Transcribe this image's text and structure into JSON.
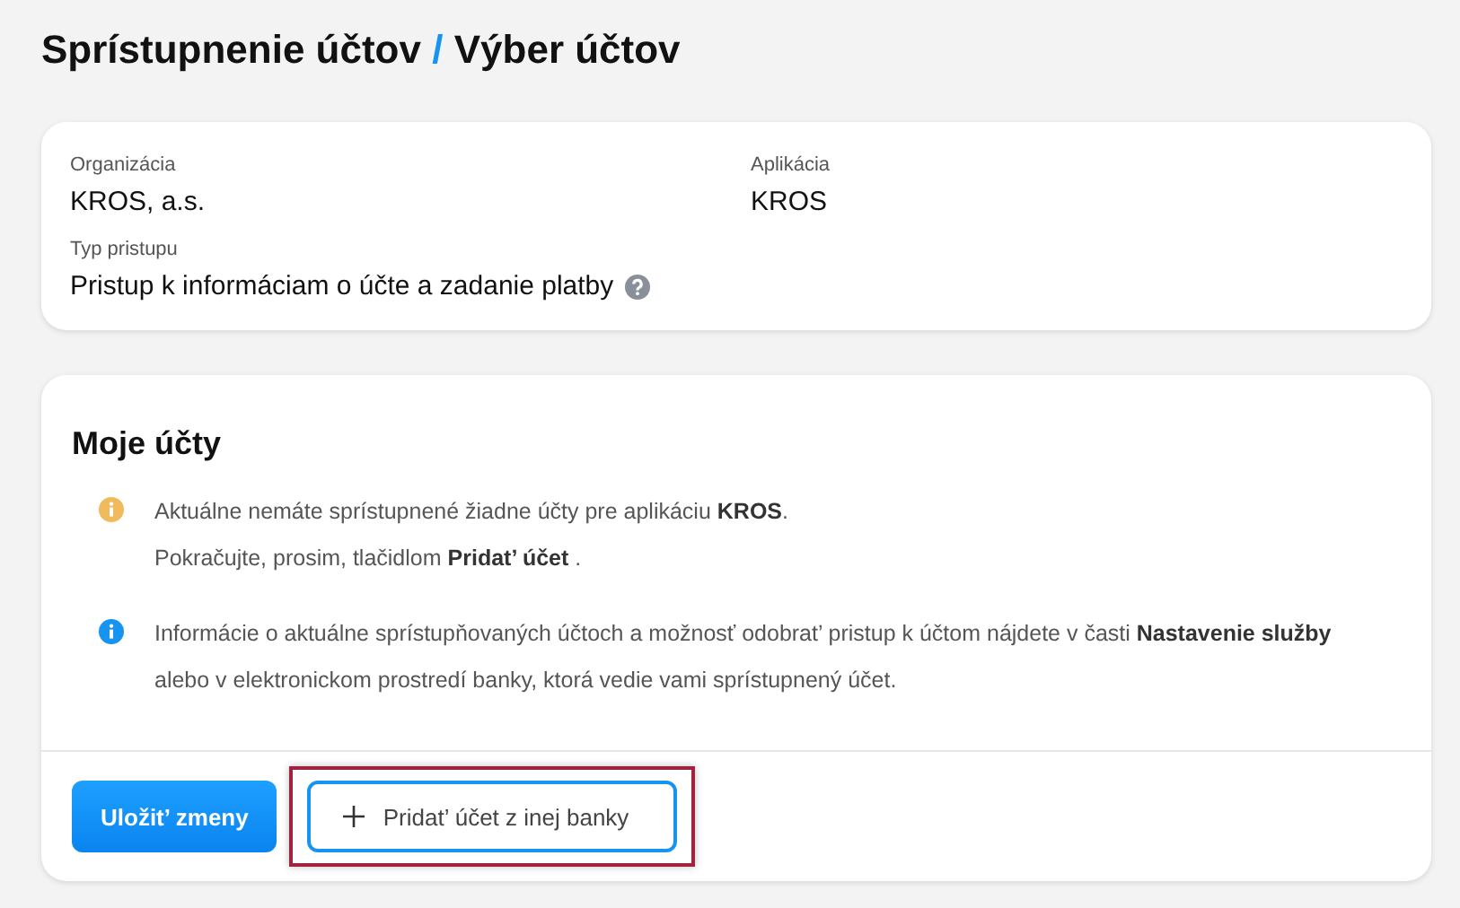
{
  "breadcrumb": [
    {
      "label": "Sprístupnenie účtov"
    },
    {
      "label": "Výber účtov"
    }
  ],
  "separator": "/",
  "details": [
    {
      "label": "Organizácia",
      "value": "KROS, a.s."
    },
    {
      "label": "Aplikácia",
      "value": "KROS"
    },
    {
      "label": "Typ pristupu",
      "value": "Pristup k informáciam o účte a zadanie platby",
      "help": true
    }
  ],
  "accounts": {
    "title": "Moje účty",
    "messages": [
      {
        "kind": "warning",
        "lines": [
          "Aktuálne nemáte sprístupnené žiadne účty pre aplikáciu **KROS**.",
          "Pokračujte, prosim, tlačidlom **Pridat’ účet** ."
        ]
      },
      {
        "kind": "info",
        "lines": [
          "Informácie o aktuálne sprístupňovaných účtoch a možnosť odobrat’ pristup k účtom nájdete v časti **Nastavenie služby** alebo v elektronickom prostredí banky, ktorá vedie vami sprístupnený účet."
        ]
      }
    ],
    "buttons": [
      {
        "kind": "primary",
        "label": "Uložit’ zmeny",
        "highlighted": false
      },
      {
        "kind": "add",
        "label": "Pridat’ účet z inej banky",
        "highlighted": true
      }
    ]
  }
}
